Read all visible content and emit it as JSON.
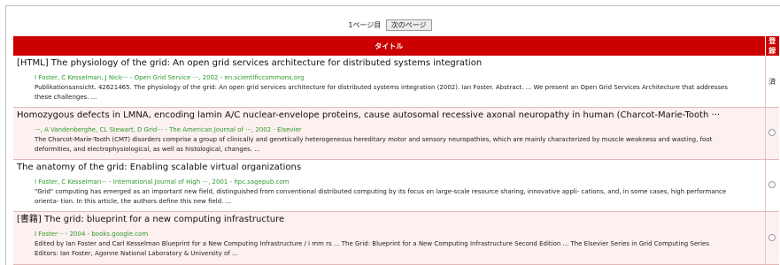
{
  "pager": {
    "page_label": "1ページ目",
    "next_label": "次のページ"
  },
  "header": {
    "title_col": "タイトル",
    "reg_col": "登録"
  },
  "rows": [
    {
      "title": "[HTML] The physiology of the grid: An open grid services architecture for distributed systems integration",
      "authors": "I Foster, C Kesselman, J Nick··· - Open Grid Service ···, 2002 - en.scientificcommons.org",
      "snippet": "Publikationsansicht. 42621465. The physiology of the grid: An open grid services architecture for distributed systems integration (2002). Ian Foster. Abstract. ... We present an Open Grid Services Architecture that addresses these challenges. ...",
      "status": "済"
    },
    {
      "title": "Homozygous defects in LMNA, encoding lamin A/C nuclear-envelope proteins, cause autosomal recessive axonal neuropathy in human (Charcot-Marie-Tooth ···",
      "authors": "···, A Vandenberghe, CL Stewart, D Grid··· - The American Journal of ···, 2002 - Elsevier",
      "snippet": "The Charcot-Marie-Tooth (CMT) disorders comprise a group of clinically and genetically heterogeneous hereditary motor and sensory neuropathies, which are mainly characterized by muscle weakness and wasting, foot deformities, and electrophysiological, as well as histological, changes. ...",
      "status": ""
    },
    {
      "title": "The anatomy of the grid: Enabling scalable virtual organizations",
      "authors": "I Foster, C Kesselman··· - International Journal of High ···, 2001 - hpc.sagepub.com",
      "snippet": "\"Grid\" computing has emerged as an important new field, distinguished from conventional distributed computing by its focus on large-scale resource sharing, innovative appli- cations, and, in some cases, high performance orienta- tion. In this article, the authors define this new field. ...",
      "status": ""
    },
    {
      "title": "[書籍] The grid: blueprint for a new computing infrastructure",
      "authors": "I Foster··· - 2004 - books.google.com",
      "snippet": "Edited by Ian Foster and Carl Kesselman Blueprint for a New Computing Infrastructure / i mm rs ... The Grid: Blueprint for a New Computing Infrastructure Second Edition ... The Elsevier Series in Grid Computing Series Editors: Ian Foster, Agonne National Laboratory & University of ...",
      "status": ""
    }
  ]
}
